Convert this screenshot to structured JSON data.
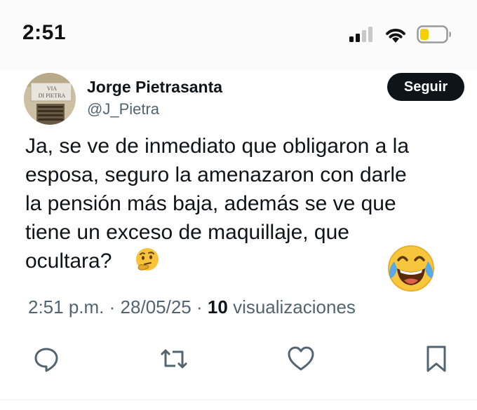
{
  "status_bar": {
    "time": "2:51",
    "icons": [
      "signal-icon",
      "wifi-icon",
      "battery-icon"
    ],
    "battery_color": "#f5d000"
  },
  "tweet": {
    "author": {
      "name": "Jorge Pietrasanta",
      "handle": "@J_Pietra",
      "avatar_icon": "street-sign-avatar",
      "avatar_sign_text": [
        "VIA",
        "DI PIETRA"
      ]
    },
    "follow_label": "Seguir",
    "text_lines": [
      "Ja, se ve de inmediato que obligaron a la",
      "esposa, seguro la amenazaron con darle",
      "la pensión más baja, además se ve que",
      "tiene un exceso de maquillaje, que",
      "ocultara?"
    ],
    "inline_emoji": "thinking-face-emoji",
    "overlay_emoji": "face-with-tears-of-joy-emoji",
    "time": "2:51 p.m.",
    "date": "28/05/25",
    "views_count": "10",
    "views_label": "visualizaciones",
    "separator": "·"
  },
  "actions": [
    {
      "name": "reply-icon"
    },
    {
      "name": "retweet-icon"
    },
    {
      "name": "like-icon"
    },
    {
      "name": "bookmark-icon"
    }
  ],
  "colors": {
    "text": "#0f1419",
    "secondary": "#536471",
    "follow_bg": "#0f1419"
  }
}
